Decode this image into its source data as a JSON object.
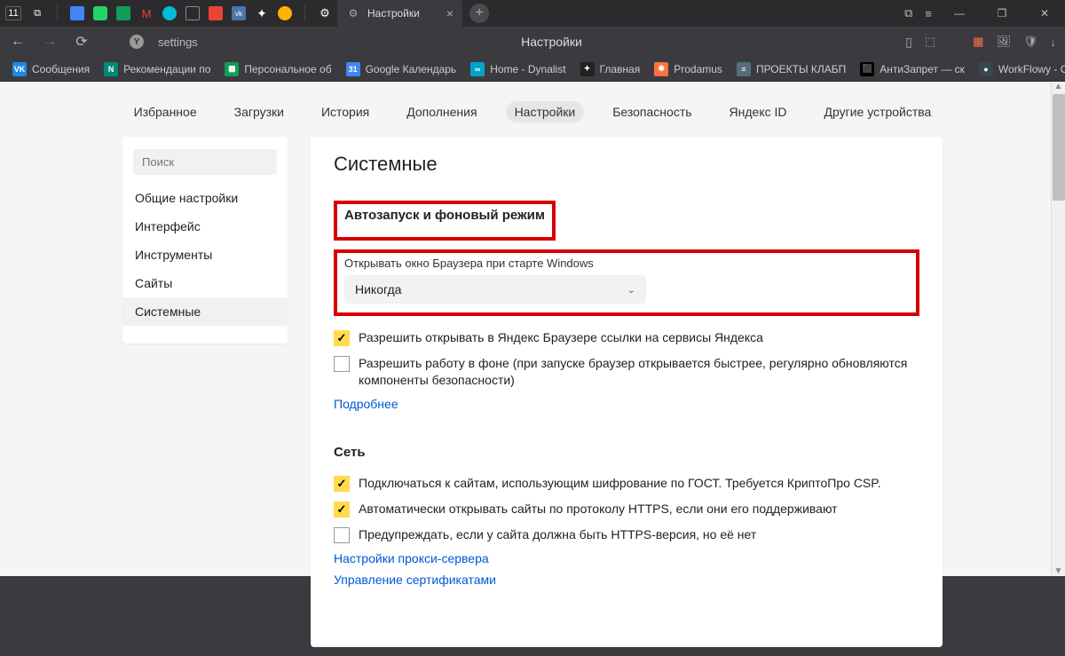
{
  "titlebar": {
    "date_badge": "11",
    "tab_title": "Настройки",
    "icons": [
      "calendar",
      "new-tab-group",
      "sep",
      "gcal",
      "whatsapp",
      "sheets",
      "gmail",
      "translate",
      "doc",
      "gmail2",
      "vk",
      "plus",
      "chat",
      "sep",
      "gear"
    ]
  },
  "addrbar": {
    "url_text": "settings",
    "page_title": "Настройки"
  },
  "bookmarks": [
    {
      "label": "Сообщения",
      "color": "#1e88e5",
      "abbr": "VK"
    },
    {
      "label": "Рекомендации по",
      "color": "#00897b",
      "abbr": "N"
    },
    {
      "label": "Персональное об",
      "color": "#0f9d58",
      "abbr": "▦"
    },
    {
      "label": "Google Календарь",
      "color": "#4285f4",
      "abbr": "31"
    },
    {
      "label": "Home - Dynalist",
      "color": "#00a3cc",
      "abbr": "∞"
    },
    {
      "label": "Главная",
      "color": "#222",
      "abbr": "✦"
    },
    {
      "label": "Prodamus",
      "color": "#ff7043",
      "abbr": "✱"
    },
    {
      "label": "ПРОЕКТЫ КЛАБП",
      "color": "#546e7a",
      "abbr": "≡"
    },
    {
      "label": "АнтиЗапрет — ск",
      "color": "#000",
      "abbr": "⬛"
    },
    {
      "label": "WorkFlowy - Orga",
      "color": "#37474f",
      "abbr": "●"
    }
  ],
  "toptabs": [
    "Избранное",
    "Загрузки",
    "История",
    "Дополнения",
    "Настройки",
    "Безопасность",
    "Яндекс ID",
    "Другие устройства"
  ],
  "toptab_active": "Настройки",
  "sidebar": {
    "search_placeholder": "Поиск",
    "items": [
      "Общие настройки",
      "Интерфейс",
      "Инструменты",
      "Сайты",
      "Системные"
    ],
    "active": "Системные"
  },
  "main": {
    "title": "Системные",
    "section_autostart": {
      "heading": "Автозапуск и фоновый режим",
      "select_label": "Открывать окно Браузера при старте Windows",
      "select_value": "Никогда",
      "chk1": {
        "checked": true,
        "text": "Разрешить открывать в Яндекс Браузере ссылки на сервисы Яндекса"
      },
      "chk2": {
        "checked": false,
        "text": "Разрешить работу в фоне (при запуске браузер открывается быстрее, регулярно обновляются компоненты безопасности)"
      },
      "link": "Подробнее"
    },
    "section_network": {
      "heading": "Сеть",
      "chk1": {
        "checked": true,
        "text": "Подключаться к сайтам, использующим шифрование по ГОСТ. Требуется КриптоПро CSP."
      },
      "chk2": {
        "checked": true,
        "text": "Автоматически открывать сайты по протоколу HTTPS, если они его поддерживают"
      },
      "chk3": {
        "checked": false,
        "text": "Предупреждать, если у сайта должна быть HTTPS-версия, но её нет"
      },
      "link1": "Настройки прокси-сервера",
      "link2": "Управление сертификатами"
    }
  }
}
